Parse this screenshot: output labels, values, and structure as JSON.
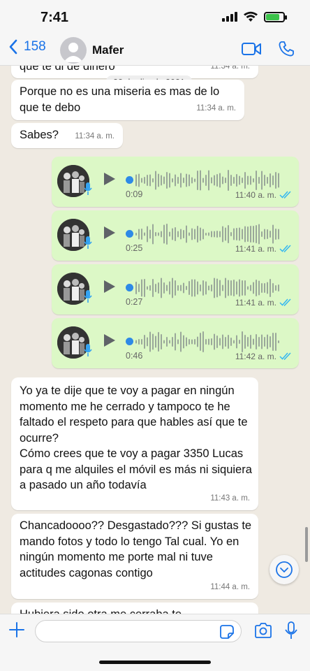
{
  "status": {
    "time": "7:41"
  },
  "header": {
    "back_count": "158",
    "contact_name": "Mafer"
  },
  "chat": {
    "date_label": "22 de dic. de 2021",
    "cut_top_text": "que te di de dinero",
    "cut_top_time": "11:34 a. m.",
    "messages": [
      {
        "text": "Porque no es una miseria es mas de lo que te debo",
        "time": "11:34 a. m."
      },
      {
        "text": "Sabes?",
        "time": "11:34 a. m."
      }
    ],
    "voice_notes": [
      {
        "duration": "0:09",
        "time": "11:40 a. m."
      },
      {
        "duration": "0:25",
        "time": "11:41 a. m."
      },
      {
        "duration": "0:27",
        "time": "11:41 a. m."
      },
      {
        "duration": "0:46",
        "time": "11:42 a. m."
      }
    ],
    "long_message_1": {
      "text": "Yo ya te dije que te voy a pagar en ningún momento me he cerrado y tampoco te he faltado el respeto para que hables así que te ocurre?\nCómo crees que te voy a pagar 3350 Lucas para q me alquiles el móvil es más ni siquiera a pasado un año todavía",
      "time": "11:43 a. m."
    },
    "long_message_2": {
      "text": "Chancadoooo??  Desgastado??? Si gustas te mando fotos y todo lo tengo Tal cual. Yo en ningún momento me porte mal ni tuve actitudes cagonas contigo",
      "time": "11:44 a. m."
    },
    "cut_bottom_text": "Hubiera sido otra me cerraba te"
  },
  "input": {
    "placeholder": ""
  },
  "colors": {
    "outgoing": "#dcf8c6",
    "incoming": "#ffffff",
    "accent": "#1a73e8",
    "tick": "#34b7f1"
  },
  "icons": [
    "back-chevron-icon",
    "video-call-icon",
    "phone-icon",
    "play-icon",
    "mic-icon",
    "double-check-icon",
    "chevron-down-icon",
    "plus-icon",
    "sticker-icon",
    "camera-icon",
    "microphone-icon"
  ]
}
